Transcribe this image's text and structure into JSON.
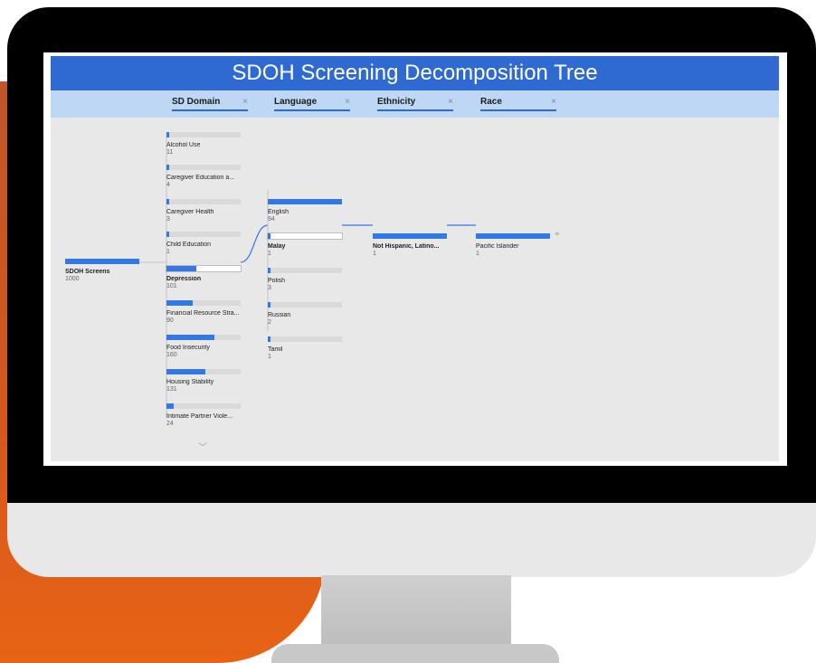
{
  "report": {
    "title": "SDOH Screening Decomposition Tree",
    "columns": [
      "SD Domain",
      "Language",
      "Ethnicity",
      "Race"
    ],
    "close_glyph": "×"
  },
  "tree": {
    "root": {
      "label": "SDOH Screens",
      "value": "1000",
      "fraction": 1.0
    },
    "sd_domain": [
      {
        "label": "Alcohol Use",
        "value": "11",
        "fraction": 0.02
      },
      {
        "label": "Caregiver Education a...",
        "value": "4",
        "fraction": 0.02
      },
      {
        "label": "Caregiver Health",
        "value": "3",
        "fraction": 0.01
      },
      {
        "label": "Child Education",
        "value": "1",
        "fraction": 0.01
      },
      {
        "label": "Depression",
        "value": "101",
        "fraction": 0.4,
        "selected": true
      },
      {
        "label": "Financial Resource Stra...",
        "value": "90",
        "fraction": 0.35
      },
      {
        "label": "Food Insecurity",
        "value": "160",
        "fraction": 0.65
      },
      {
        "label": "Housing Stability",
        "value": "131",
        "fraction": 0.53
      },
      {
        "label": "Intimate Partner Viole...",
        "value": "24",
        "fraction": 0.1
      }
    ],
    "language": [
      {
        "label": "English",
        "value": "94",
        "fraction": 1.0
      },
      {
        "label": "Malay",
        "value": "1",
        "fraction": 0.01,
        "selected": true
      },
      {
        "label": "Polish",
        "value": "3",
        "fraction": 0.03
      },
      {
        "label": "Russian",
        "value": "2",
        "fraction": 0.02
      },
      {
        "label": "Tamil",
        "value": "1",
        "fraction": 0.01
      }
    ],
    "ethnicity": [
      {
        "label": "Not Hispanic, Latino...",
        "value": "1",
        "fraction": 1.0,
        "bold": true
      }
    ],
    "race": [
      {
        "label": "Pacific Islander",
        "value": "1",
        "fraction": 1.0
      }
    ],
    "expand_glyph": "+",
    "more_glyph": "﹀"
  },
  "colors": {
    "accent": "#3478e6",
    "title_bar": "#2f6ad3",
    "header_bar": "#bdd7f4",
    "brand_orange": "#e86315"
  }
}
